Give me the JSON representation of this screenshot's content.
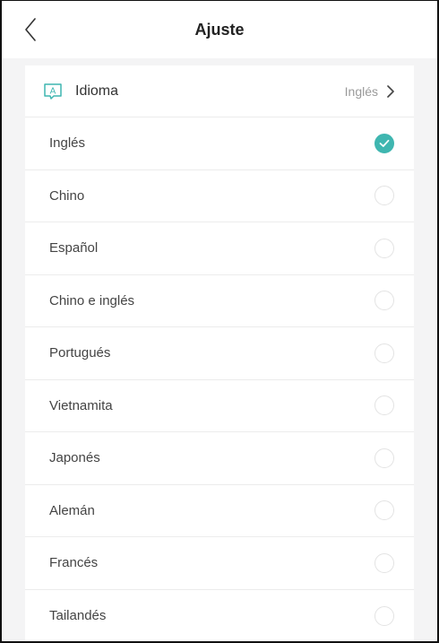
{
  "header": {
    "title": "Ajuste",
    "back_icon": "chevron-left-icon"
  },
  "language_setting": {
    "label": "Idioma",
    "current_value": "Inglés",
    "icon": "language-icon",
    "icon_glyph": "A"
  },
  "languages": [
    {
      "label": "Inglés",
      "selected": true
    },
    {
      "label": "Chino",
      "selected": false
    },
    {
      "label": "Español",
      "selected": false
    },
    {
      "label": "Chino e inglés",
      "selected": false
    },
    {
      "label": "Portugués",
      "selected": false
    },
    {
      "label": "Vietnamita",
      "selected": false
    },
    {
      "label": "Japonés",
      "selected": false
    },
    {
      "label": "Alemán",
      "selected": false
    },
    {
      "label": "Francés",
      "selected": false
    },
    {
      "label": "Tailandés",
      "selected": false
    }
  ],
  "colors": {
    "accent": "#3fb6b0",
    "text": "#444444",
    "muted": "#9a9a9a"
  }
}
